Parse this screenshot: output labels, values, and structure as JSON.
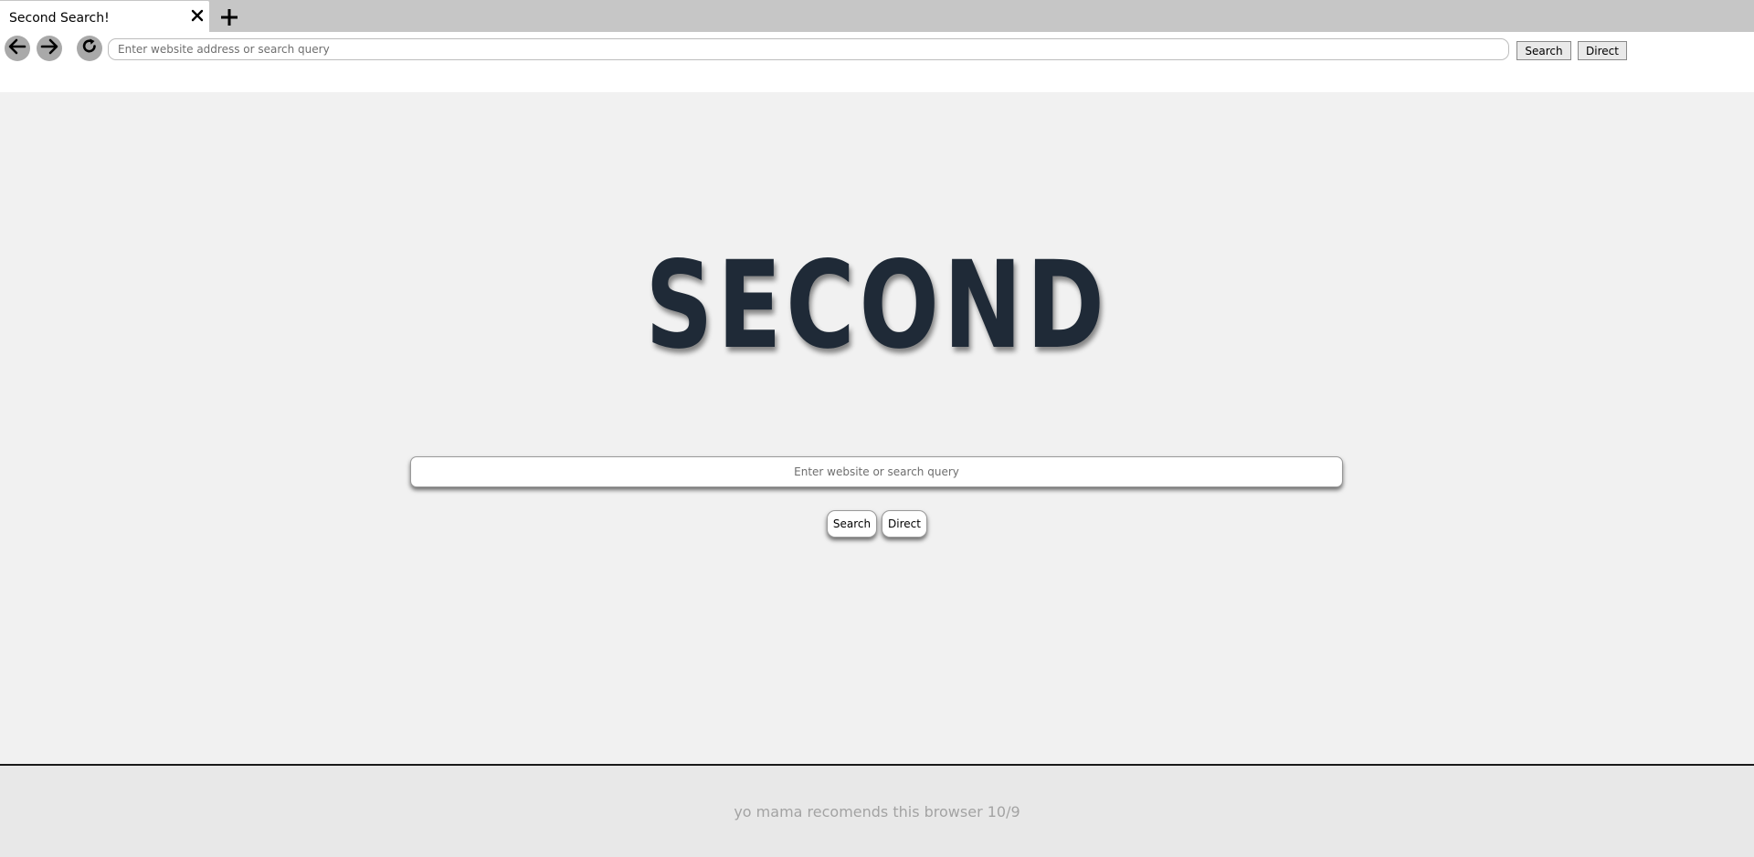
{
  "tabbar": {
    "active_tab_title": "Second Search!"
  },
  "toolbar": {
    "address_placeholder": "Enter website address or search query",
    "address_value": "",
    "search_label": "Search",
    "direct_label": "Direct"
  },
  "main": {
    "logo_text": "SECOND",
    "search_placeholder": "Enter website or search query",
    "search_value": "",
    "search_label": "Search",
    "direct_label": "Direct"
  },
  "footer": {
    "text": "yo mama recomends this browser 10/9"
  },
  "icons": {
    "back": "arrow-left-icon",
    "forward": "arrow-right-icon",
    "reload": "reload-icon",
    "close": "close-icon",
    "new_tab": "plus-icon"
  },
  "colors": {
    "logo": "#1f2a37",
    "tabbar_bg": "#c6c6c6",
    "page_bg": "#f1f1f1",
    "footer_bg": "#e8e8e8",
    "footer_text": "#a3a3a3"
  }
}
